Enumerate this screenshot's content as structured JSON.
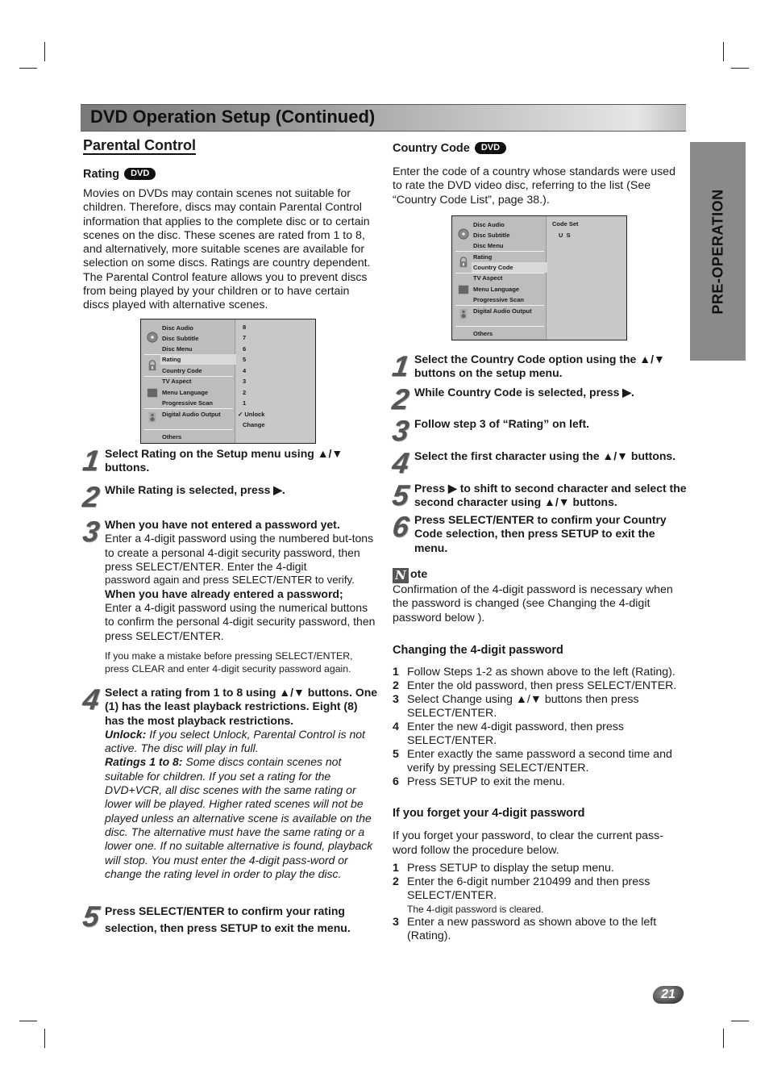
{
  "header": {
    "title": "DVD Operation Setup (Continued)"
  },
  "side_tab": {
    "label": "PRE-OPERATION"
  },
  "badge_label": "DVD",
  "left": {
    "section_title": "Parental Control",
    "rating_heading": "Rating",
    "intro": "Movies on DVDs may contain scenes not suitable for children. Therefore, discs may contain Parental Control information that applies to the complete disc or to certain scenes on the disc. These scenes are rated from 1 to 8, and alternatively, more suitable scenes are available for selection on some discs. Ratings are country dependent. The Parental Control feature allows you to prevent discs from being played by your children or to have certain discs played with alternative scenes.",
    "menu": {
      "items": [
        "Disc Audio",
        "Disc Subtitle",
        "Disc Menu",
        "Rating",
        "Country Code",
        "TV Aspect",
        "Menu Language",
        "Progressive Scan",
        "Digital Audio Output",
        "Others"
      ],
      "selected": "Rating",
      "options": [
        "8",
        "7",
        "6",
        "5",
        "4",
        "3",
        "2",
        "1",
        "Unlock",
        "Change"
      ],
      "checked_option": "Unlock",
      "check_mark": "✓"
    },
    "steps": [
      {
        "num": "1",
        "bold": "Select Rating on the Setup menu using ▲/▼ buttons."
      },
      {
        "num": "2",
        "bold": "While Rating is selected, press ▶."
      },
      {
        "num": "3",
        "heading1": "When you have not entered a password yet.",
        "text1": "Enter a 4-digit password using the numbered but-tons to create a personal 4-digit security password, then press SELECT/ENTER. Enter the 4-digit",
        "text1b": "password again and press SELECT/ENTER to verify.",
        "heading2": "When you have already entered a password;",
        "text2": "Enter a 4-digit password using the numerical buttons to confirm the personal 4-digit security password, then press SELECT/ENTER.",
        "tip": "If you make a mistake before pressing SELECT/ENTER, press CLEAR and enter 4-digit security password again."
      },
      {
        "num": "4",
        "bold": "Select a rating from 1 to 8 using ▲/▼ buttons. One (1) has the least playback restrictions. Eight (8) has the most playback restrictions.",
        "unlock_label": "Unlock:",
        "unlock_text": " If you select Unlock, Parental Control is not active. The disc will play in full.",
        "ratings_label": "Ratings 1 to 8:",
        "ratings_text": " Some discs contain scenes not suitable for children. If you set a rating for the DVD+VCR, all disc scenes with the same rating or lower will be played. Higher rated scenes will not be played unless an alternative scene is available on the disc. The alternative must have the same rating or a lower one. If no suitable alternative is found, playback will stop. You must enter the 4-digit pass-word or change the rating level in order to play the disc."
      },
      {
        "num": "5",
        "bold": "Press SELECT/ENTER to confirm your rating selection, then press SETUP to exit the menu."
      }
    ]
  },
  "right": {
    "country_heading": "Country Code",
    "intro": "Enter the code of a country whose standards were used to rate the DVD video disc, referring to the list (See “Country Code List”, page 38.).",
    "menu": {
      "items": [
        "Disc Audio",
        "Disc Subtitle",
        "Disc Menu",
        "Rating",
        "Country Code",
        "TV Aspect",
        "Menu Language",
        "Progressive Scan",
        "Digital Audio Output",
        "Others"
      ],
      "selected": "Country Code",
      "code_label": "Code Set",
      "code_value": "U  S"
    },
    "steps": [
      {
        "num": "1",
        "bold": "Select the Country Code option using the ▲/▼ buttons on the setup menu."
      },
      {
        "num": "2",
        "bold": "While Country Code is selected, press ▶."
      },
      {
        "num": "3",
        "bold": "Follow step 3 of “Rating” on left."
      },
      {
        "num": "4",
        "bold": "Select the first character using the ▲/▼ buttons."
      },
      {
        "num": "5",
        "bold": "Press ▶ to shift to second character and select the second character using ▲/▼ buttons."
      },
      {
        "num": "6",
        "bold": "Press SELECT/ENTER to confirm your Country Code selection, then press SETUP to exit the menu."
      }
    ],
    "note": {
      "icon_letter": "N",
      "label": "ote",
      "text": "Confirmation of the 4-digit password is necessary when the password is changed (see Changing the 4-digit password below )."
    },
    "changing": {
      "heading": "Changing the 4-digit password",
      "items": [
        {
          "n": "1",
          "text": "Follow Steps 1-2 as shown above to the left (Rating)."
        },
        {
          "n": "2",
          "text": "Enter the old password, then press SELECT/ENTER."
        },
        {
          "n": "3",
          "text": "Select Change using ▲/▼ buttons then press SELECT/ENTER."
        },
        {
          "n": "4",
          "text": "Enter the new 4-digit password, then press SELECT/ENTER."
        },
        {
          "n": "5",
          "text": "Enter exactly the same password a second time and verify by pressing SELECT/ENTER."
        },
        {
          "n": "6",
          "text": "Press SETUP to exit the menu."
        }
      ]
    },
    "forget": {
      "heading": "If you forget your 4-digit password",
      "intro": "If you forget your password, to clear the current pass-word follow the procedure below.",
      "items": [
        {
          "n": "1",
          "text": "Press SETUP to display the setup menu."
        },
        {
          "n": "2",
          "text": "Enter the 6-digit number 210499 and then press SELECT/ENTER.",
          "sub": "The 4-digit password is cleared."
        },
        {
          "n": "3",
          "text": "Enter a new password as shown above to the left (Rating)."
        }
      ]
    }
  },
  "footer": {
    "page_number": "21"
  }
}
